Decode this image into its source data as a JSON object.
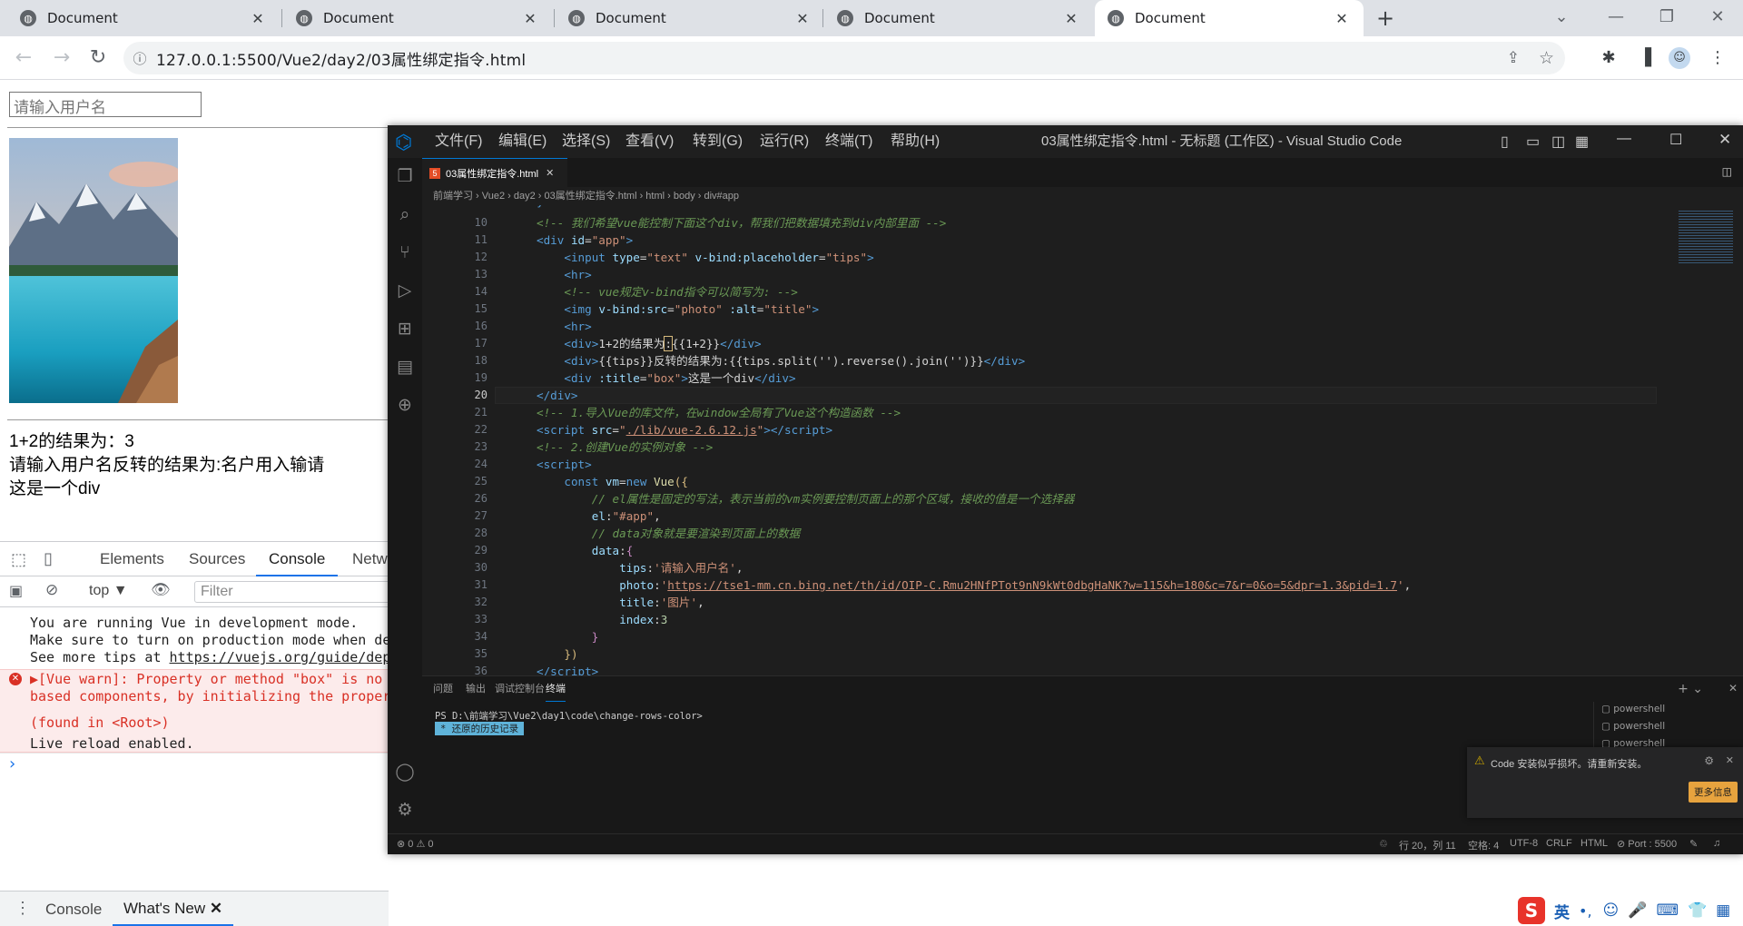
{
  "browser": {
    "tabs": [
      {
        "title": "Document",
        "active": false
      },
      {
        "title": "Document",
        "active": false
      },
      {
        "title": "Document",
        "active": false
      },
      {
        "title": "Document",
        "active": false
      },
      {
        "title": "Document",
        "active": true
      }
    ],
    "url": "127.0.0.1:5500/Vue2/day2/03属性绑定指令.html"
  },
  "page": {
    "input_placeholder": "请输入用户名",
    "line1": "1+2的结果为：3",
    "line2": "请输入用户名反转的结果为:名户用入输请",
    "line3": "这是一个div"
  },
  "devtools": {
    "tabs": [
      "Elements",
      "Sources",
      "Console",
      "Netw"
    ],
    "active_tab": "Console",
    "context": "top",
    "filter_placeholder": "Filter",
    "console": [
      {
        "text": "You are running Vue in development mode.",
        "level": "info"
      },
      {
        "text": "Make sure to turn on production mode when de",
        "level": "info"
      },
      {
        "text": "See more tips at ",
        "link": "https://vuejs.org/guide/dep",
        "level": "info"
      },
      {
        "text": "▶[Vue warn]: Property or method \"box\" is no",
        "level": "warn"
      },
      {
        "text": "based components, by initializing the proper",
        "level": "warn"
      },
      {
        "text": "",
        "level": "warn"
      },
      {
        "text": "(found in <Root>)",
        "level": "warn"
      },
      {
        "text": "Live reload enabled.",
        "level": "info"
      }
    ],
    "prompt": "›",
    "drawer_tabs": [
      "Console",
      "What's New"
    ]
  },
  "vscode": {
    "title": "03属性绑定指令.html - 无标题 (工作区) - Visual Studio Code",
    "menu": [
      "文件(F)",
      "编辑(E)",
      "选择(S)",
      "查看(V)",
      "转到(G)",
      "运行(R)",
      "终端(T)",
      "帮助(H)"
    ],
    "tab": "03属性绑定指令.html",
    "breadcrumbs": "前端学习 › Vue2 › day2 › 03属性绑定指令.html › html › body › div#app",
    "code": [
      {
        "n": 10,
        "html": "<span class='c-cm'>&lt;!-- 我们希望vue能控制下面这个div，帮我们把数据填充到div内部里面 --&gt;</span>",
        "indent": 2
      },
      {
        "n": 11,
        "html": "<span class='c-tag'>&lt;div</span> <span class='c-attr'>id</span>=<span class='c-str'>\"app\"</span><span class='c-tag'>&gt;</span>",
        "indent": 2
      },
      {
        "n": 12,
        "html": "<span class='c-tag'>&lt;input</span> <span class='c-attr'>type</span>=<span class='c-str'>\"text\"</span> <span class='c-attr'>v-bind:placeholder</span>=<span class='c-str'>\"tips\"</span><span class='c-tag'>&gt;</span>",
        "indent": 3
      },
      {
        "n": 13,
        "html": "<span class='c-tag'>&lt;hr&gt;</span>",
        "indent": 3
      },
      {
        "n": 14,
        "html": "<span class='c-cm'>&lt;!-- vue规定v-bind指令可以简写为: --&gt;</span>",
        "indent": 3
      },
      {
        "n": 15,
        "html": "<span class='c-tag'>&lt;img</span> <span class='c-attr'>v-bind:src</span>=<span class='c-str'>\"photo\"</span> <span class='c-attr'>:alt</span>=<span class='c-str'>\"title\"</span><span class='c-tag'>&gt;</span>",
        "indent": 3
      },
      {
        "n": 16,
        "html": "<span class='c-tag'>&lt;hr&gt;</span>",
        "indent": 3
      },
      {
        "n": 17,
        "html": "<span class='c-tag'>&lt;div&gt;</span>1+2的结果为<span style='outline:1px solid #d7ba7d'>:</span>{{1+2}}<span class='c-tag'>&lt;/div&gt;</span>",
        "indent": 3
      },
      {
        "n": 18,
        "html": "<span class='c-tag'>&lt;div&gt;</span>{{tips}}反转的结果为:{{tips.split('').reverse().join('')}}<span class='c-tag'>&lt;/div&gt;</span>",
        "indent": 3
      },
      {
        "n": 19,
        "html": "<span class='c-tag'>&lt;div</span> <span class='c-attr'>:title</span>=<span class='c-str'>\"box\"</span><span class='c-tag'>&gt;</span>这是一个div<span class='c-tag'>&lt;/div&gt;</span>",
        "indent": 3
      },
      {
        "n": 20,
        "html": "<span class='c-tag'>&lt;/div&gt;</span>",
        "indent": 2,
        "current": true
      },
      {
        "n": 21,
        "html": "<span class='c-cm'>&lt;!-- 1.导入Vue的库文件，在window全局有了Vue这个构造函数 --&gt;</span>",
        "indent": 2
      },
      {
        "n": 22,
        "html": "<span class='c-tag'>&lt;script</span> <span class='c-attr'>src</span>=<span class='c-str'>\"<u>./lib/vue-2.6.12.js</u>\"</span><span class='c-tag'>&gt;&lt;/script&gt;</span>",
        "indent": 2
      },
      {
        "n": 23,
        "html": "<span class='c-cm'>&lt;!-- 2.创建Vue的实例对象 --&gt;</span>",
        "indent": 2
      },
      {
        "n": 24,
        "html": "<span class='c-tag'>&lt;script&gt;</span>",
        "indent": 2
      },
      {
        "n": 25,
        "html": "<span class='c-tag'>const</span> <span class='c-var'>vm</span>=<span class='c-tag'>new</span> <span class='c-fn'>Vue</span><span class='c-yel'>({</span>",
        "indent": 3
      },
      {
        "n": 26,
        "html": "<span class='c-cm'>// el属性是固定的写法，表示当前的vm实例要控制页面上的那个区域，接收的值是一个选择器</span>",
        "indent": 4
      },
      {
        "n": 27,
        "html": "<span class='c-var'>el</span>:<span class='c-str'>\"#app\"</span>,",
        "indent": 4
      },
      {
        "n": 28,
        "html": "<span class='c-cm'>// data对象就是要渲染到页面上的数据</span>",
        "indent": 4
      },
      {
        "n": 29,
        "html": "<span class='c-var'>data</span>:<span class='c-kw'>{</span>",
        "indent": 4
      },
      {
        "n": 30,
        "html": "<span class='c-var'>tips</span>:<span class='c-str'>'请输入用户名'</span>,",
        "indent": 5
      },
      {
        "n": 31,
        "html": "<span class='c-var'>photo</span>:<span class='c-str'>'<u>https://tse1-mm.cn.bing.net/th/id/OIP-C.Rmu2HNfPTot9nN9kWt0dbgHaNK?w=115&amp;h=180&amp;c=7&amp;r=0&amp;o=5&amp;dpr=1.3&amp;pid=1.7</u>'</span>,",
        "indent": 5
      },
      {
        "n": 32,
        "html": "<span class='c-var'>title</span>:<span class='c-str'>'图片'</span>,",
        "indent": 5
      },
      {
        "n": 33,
        "html": "<span class='c-var'>index</span>:<span style='color:#b5cea8'>3</span>",
        "indent": 5
      },
      {
        "n": 34,
        "html": "<span class='c-kw'>}</span>",
        "indent": 4
      },
      {
        "n": 35,
        "html": "<span class='c-yel'>})</span>",
        "indent": 3
      },
      {
        "n": 36,
        "html": "<span class='c-tag'>&lt;/script&gt;</span>",
        "indent": 2
      }
    ],
    "panel_tabs": [
      "问题",
      "输出",
      "调试控制台",
      "终端"
    ],
    "panel_active": "终端",
    "terminal_line1": "PS D:\\前端学习\\Vue2\\day1\\code\\change-rows-color>",
    "terminal_line2": "还原的历史记录",
    "terminal_list": [
      "powershell",
      "powershell",
      "powershell"
    ],
    "notification": "Code 安装似乎损坏。请重新安装。",
    "notification_btn": "更多信息",
    "status_left": "⊗ 0 ⚠ 0",
    "status_right": [
      "行 20，列 11",
      "空格: 4",
      "UTF-8",
      "CRLF",
      "HTML",
      "⊘ Port : 5500"
    ]
  },
  "ime": {
    "lang": "英"
  }
}
